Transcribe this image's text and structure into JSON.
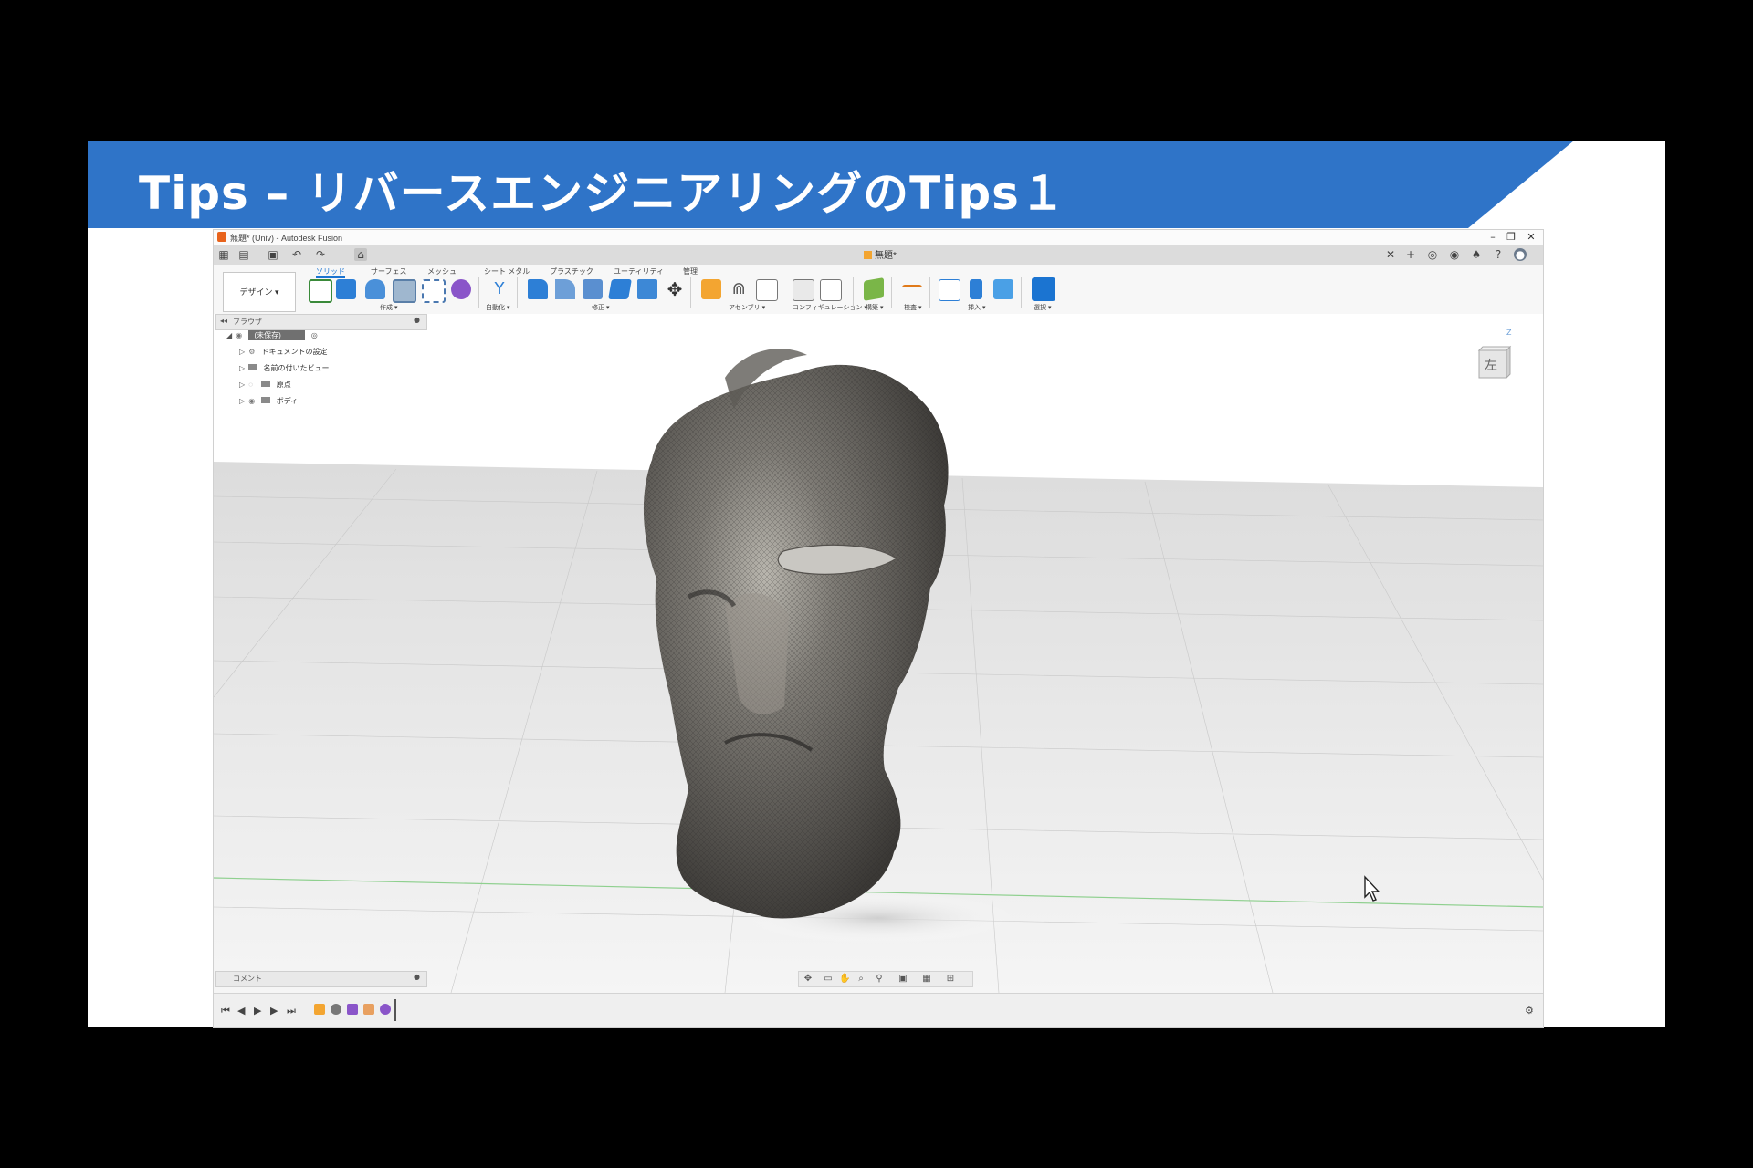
{
  "slide": {
    "title": "Tips – リバースエンジニアリングのTips１",
    "banner_color": "#2f74c8"
  },
  "app": {
    "window_title": "無題* (Univ) - Autodesk Fusion",
    "document_tab": "無題*",
    "workspace_button": "デザイン ▾",
    "ribbon_tabs": [
      "ソリッド",
      "サーフェス",
      "メッシュ",
      "シート メタル",
      "プラスチック",
      "ユーティリティ",
      "管理"
    ],
    "ribbon_groups": [
      "作成 ▾",
      "自動化 ▾",
      "修正 ▾",
      "アセンブリ ▾",
      "コンフィギュレーション ▾",
      "構築 ▾",
      "検査 ▾",
      "挿入 ▾",
      "選択 ▾"
    ],
    "browser": {
      "header": "ブラウザ",
      "root": "(未保存)",
      "items": [
        "ドキュメントの設定",
        "名前の付いたビュー",
        "原点",
        "ボディ"
      ]
    },
    "comments_label": "コメント",
    "viewcube_face": "左",
    "viewcube_axis": "Z",
    "accent_color": "#1b74d1"
  }
}
